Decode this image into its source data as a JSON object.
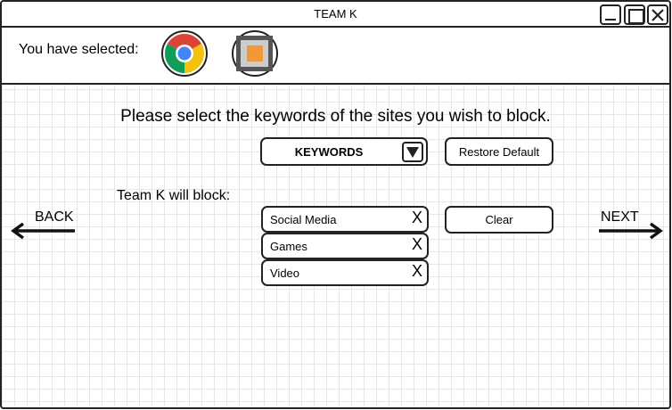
{
  "window": {
    "title": "TEAM K",
    "controls": [
      "minimize-icon",
      "maximize-icon",
      "close-icon"
    ]
  },
  "selection": {
    "label": "You have selected:",
    "apps": [
      {
        "name": "chrome-icon"
      },
      {
        "name": "orange-square-app-icon"
      }
    ]
  },
  "main": {
    "heading": "Please select the keywords of the sites you wish to block.",
    "dropdown": {
      "label": "KEYWORDS",
      "icon": "dropdown-arrow-icon"
    },
    "restore_label": "Restore Default",
    "block_label": "Team K will block:",
    "clear_label": "Clear",
    "keywords": [
      {
        "label": "Social Media",
        "remove": "X"
      },
      {
        "label": "Games",
        "remove": "X"
      },
      {
        "label": "Video",
        "remove": "X"
      }
    ]
  },
  "nav": {
    "back_label": "BACK",
    "next_label": "NEXT"
  },
  "colors": {
    "border": "#222222",
    "grid": "#e6e6e6",
    "accent_orange": "#f0983a"
  }
}
